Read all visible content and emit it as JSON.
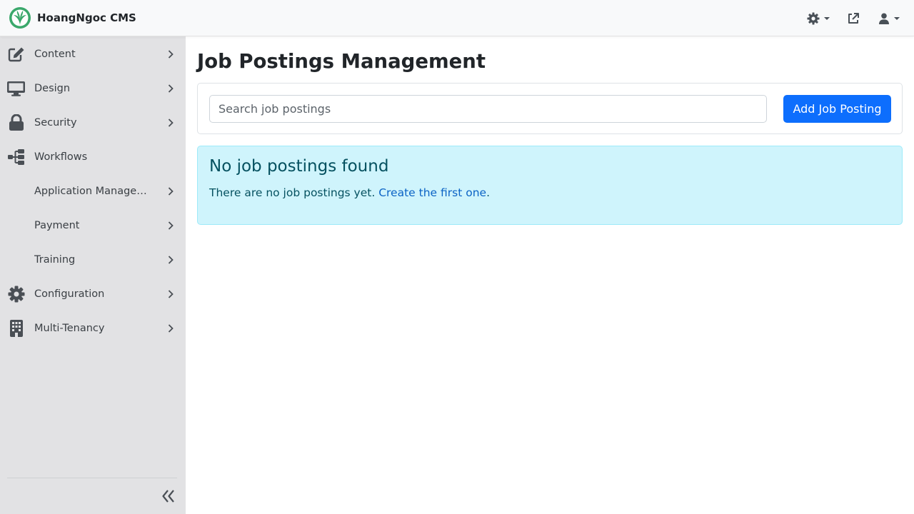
{
  "app": {
    "brand_name": "HoangNgoc CMS"
  },
  "navbar": {
    "icons": [
      "theme-gear-icon",
      "external-link-icon",
      "user-icon"
    ]
  },
  "sidebar": {
    "items": [
      {
        "label": "Content",
        "icon": "edit-icon",
        "has_chevron": true
      },
      {
        "label": "Design",
        "icon": "monitor-icon",
        "has_chevron": true
      },
      {
        "label": "Security",
        "icon": "lock-icon",
        "has_chevron": true
      },
      {
        "label": "Workflows",
        "icon": "sitemap-icon",
        "has_chevron": false
      },
      {
        "label": "Application Managem...",
        "icon": "",
        "has_chevron": true
      },
      {
        "label": "Payment",
        "icon": "",
        "has_chevron": true
      },
      {
        "label": "Training",
        "icon": "",
        "has_chevron": true
      },
      {
        "label": "Configuration",
        "icon": "gear-icon",
        "has_chevron": true
      },
      {
        "label": "Multi-Tenancy",
        "icon": "building-icon",
        "has_chevron": true
      }
    ]
  },
  "main": {
    "title": "Job Postings Management",
    "search": {
      "placeholder": "Search job postings",
      "value": ""
    },
    "add_button_label": "Add Job Posting",
    "alert": {
      "heading": "No job postings found",
      "text": "There are no job postings yet.",
      "link_text": "Create the first one",
      "suffix": "."
    }
  },
  "colors": {
    "accent": "#0d6efd",
    "sidebar_bg": "#e2e2e4",
    "alert_bg": "#cff4fc",
    "alert_text": "#055160",
    "logo_green": "#3aa86b"
  }
}
